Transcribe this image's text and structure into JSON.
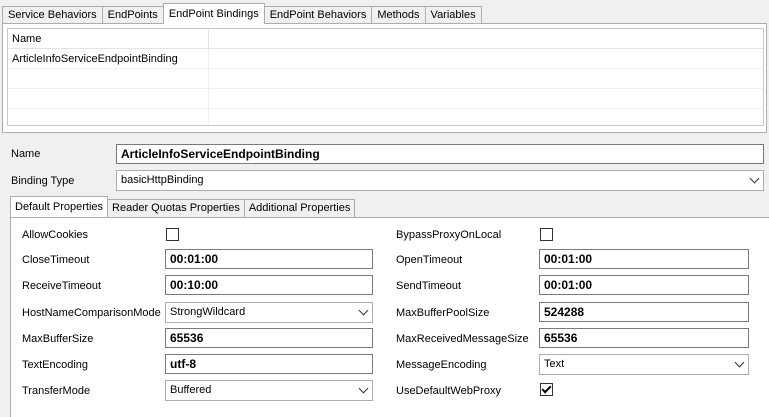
{
  "top_tabs": [
    "Service Behaviors",
    "EndPoints",
    "EndPoint Bindings",
    "EndPoint Behaviors",
    "Methods",
    "Variables"
  ],
  "active_top_tab": "EndPoint Bindings",
  "list": {
    "header": "Name",
    "rows": [
      "ArticleInfoServiceEndpointBinding"
    ]
  },
  "name_field": {
    "label": "Name",
    "value": "ArticleInfoServiceEndpointBinding"
  },
  "binding_type": {
    "label": "Binding Type",
    "value": "basicHttpBinding"
  },
  "inner_tabs": [
    "Default Properties",
    "Reader Quotas Properties",
    "Additional Properties"
  ],
  "active_inner_tab": "Default Properties",
  "properties": {
    "allow_cookies": {
      "label": "AllowCookies",
      "checked": false
    },
    "close_timeout": {
      "label": "CloseTimeout",
      "value": "00:01:00"
    },
    "receive_timeout": {
      "label": "ReceiveTimeout",
      "value": "00:10:00"
    },
    "host_name_comparison_mode": {
      "label": "HostNameComparisonMode",
      "value": "StrongWildcard"
    },
    "max_buffer_size": {
      "label": "MaxBufferSize",
      "value": "65536"
    },
    "text_encoding": {
      "label": "TextEncoding",
      "value": "utf-8"
    },
    "transfer_mode": {
      "label": "TransferMode",
      "value": "Buffered"
    },
    "bypass_proxy_on_local": {
      "label": "BypassProxyOnLocal",
      "checked": false
    },
    "open_timeout": {
      "label": "OpenTimeout",
      "value": "00:01:00"
    },
    "send_timeout": {
      "label": "SendTimeout",
      "value": "00:01:00"
    },
    "max_buffer_pool_size": {
      "label": "MaxBufferPoolSize",
      "value": "524288"
    },
    "max_received_message_size": {
      "label": "MaxReceivedMessageSize",
      "value": "65536"
    },
    "message_encoding": {
      "label": "MessageEncoding",
      "value": "Text"
    },
    "use_default_web_proxy": {
      "label": "UseDefaultWebProxy",
      "checked": true
    }
  },
  "icons": {
    "dropdown": "chevron-down-icon",
    "check": "check-icon"
  }
}
